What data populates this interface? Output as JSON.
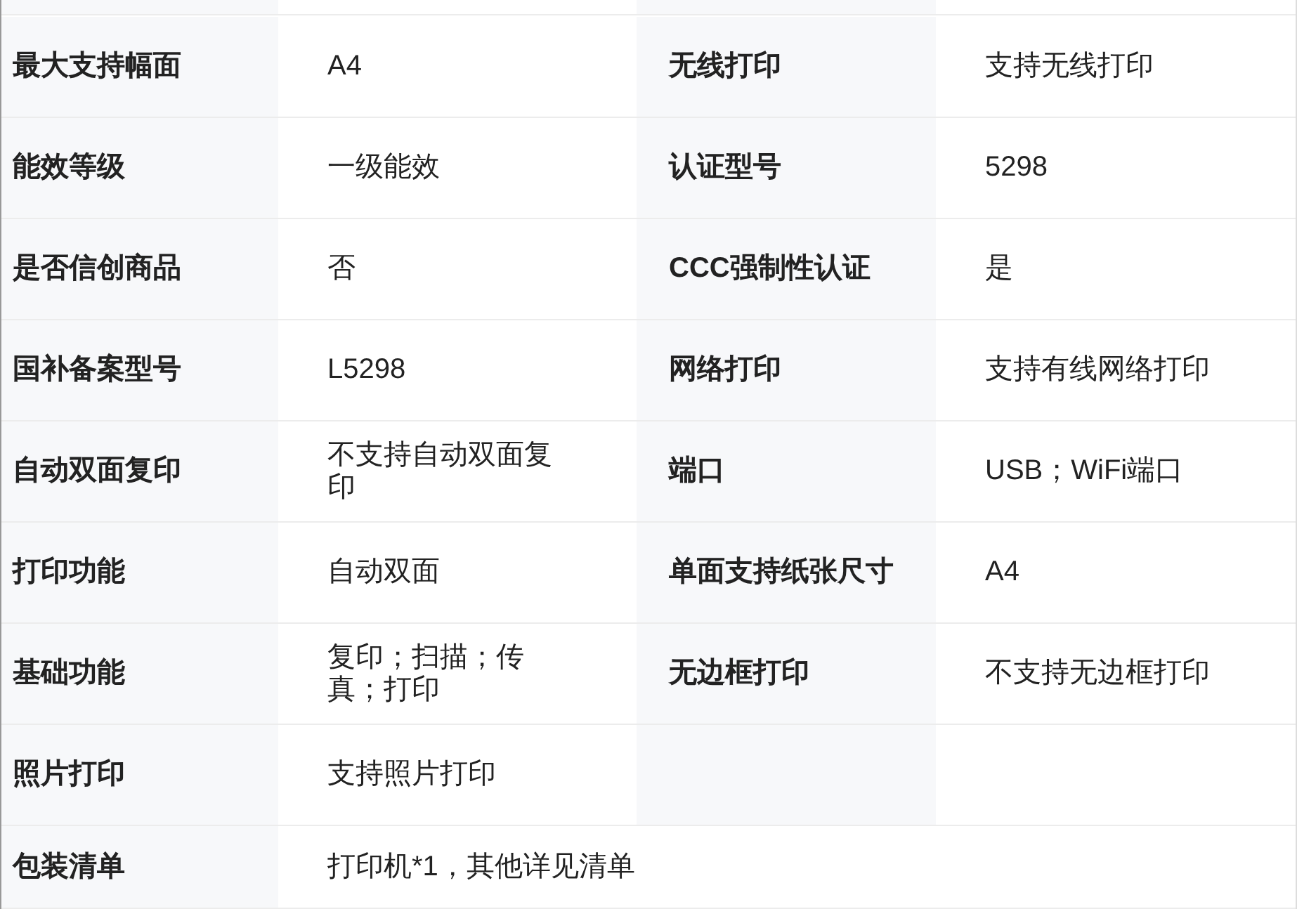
{
  "spec_table": {
    "rows": [
      {
        "kind": "pair",
        "label": "最大支持幅面",
        "value": "A4",
        "label_2": "无线打印",
        "value_2": "支持无线打印"
      },
      {
        "kind": "pair",
        "label": "能效等级",
        "value": "一级能效",
        "label_2": "认证型号",
        "value_2": "5298"
      },
      {
        "kind": "pair",
        "label": "是否信创商品",
        "value": "否",
        "label_2": "CCC强制性认证",
        "value_2": "是"
      },
      {
        "kind": "pair",
        "label": "国补备案型号",
        "value": "L5298",
        "label_2": "网络打印",
        "value_2": "支持有线网络打印"
      },
      {
        "kind": "pair",
        "label": "自动双面复印",
        "value": "不支持自动双面复印",
        "label_2": "端口",
        "value_2": "USB；WiFi端口"
      },
      {
        "kind": "pair",
        "label": "打印功能",
        "value": "自动双面",
        "label_2": "单面支持纸张尺寸",
        "value_2": "A4"
      },
      {
        "kind": "pair",
        "label": "基础功能",
        "value": "复印；扫描；传真；打印",
        "label_2": "无边框打印",
        "value_2": "不支持无边框打印"
      },
      {
        "kind": "pair",
        "label": "照片打印",
        "value": "支持照片打印"
      },
      {
        "kind": "single",
        "label": "包装清单",
        "value": "打印机*1，其他详见清单"
      }
    ]
  }
}
